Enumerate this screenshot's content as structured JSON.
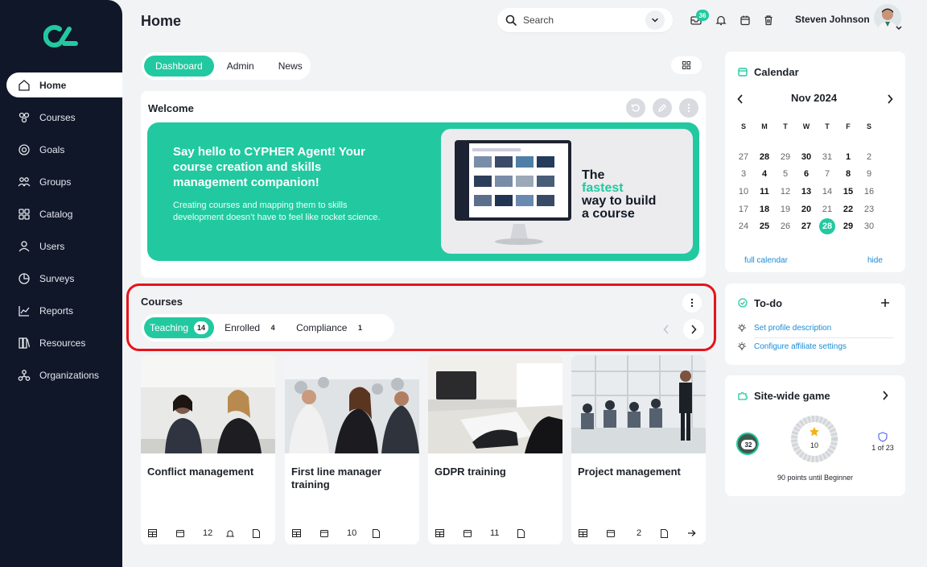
{
  "sidebar": {
    "items": [
      {
        "label": "Home",
        "icon": "home-icon"
      },
      {
        "label": "Courses",
        "icon": "courses-icon"
      },
      {
        "label": "Goals",
        "icon": "goals-icon"
      },
      {
        "label": "Groups",
        "icon": "groups-icon"
      },
      {
        "label": "Catalog",
        "icon": "catalog-icon"
      },
      {
        "label": "Users",
        "icon": "users-icon"
      },
      {
        "label": "Surveys",
        "icon": "surveys-icon"
      },
      {
        "label": "Reports",
        "icon": "reports-icon"
      },
      {
        "label": "Resources",
        "icon": "resources-icon"
      },
      {
        "label": "Organizations",
        "icon": "organizations-icon"
      }
    ]
  },
  "header": {
    "title": "Home",
    "search_label": "Search",
    "inbox_count": "36",
    "user_name": "Steven Johnson"
  },
  "tabs": [
    "Dashboard",
    "Admin",
    "News"
  ],
  "welcome": {
    "title": "Welcome",
    "headline": "Say hello to CYPHER Agent! Your course creation and skills management companion!",
    "body": "Creating courses and mapping them to skills development doesn’t have to feel like rocket science.",
    "tagline_1": "The",
    "tagline_2": "fastest",
    "tagline_3": "way to build",
    "tagline_4": "a course"
  },
  "courses": {
    "title": "Courses",
    "tabs": [
      {
        "label": "Teaching",
        "count": "14"
      },
      {
        "label": "Enrolled",
        "count": "4"
      },
      {
        "label": "Compliance",
        "count": "1"
      }
    ],
    "cards": [
      {
        "title": "Conflict management",
        "count": "12"
      },
      {
        "title": "First line manager training",
        "count": "10"
      },
      {
        "title": "GDPR training",
        "count": "11"
      },
      {
        "title": "Project management",
        "count": "2"
      }
    ]
  },
  "calendar": {
    "title": "Calendar",
    "month": "Nov 2024",
    "dow": [
      "S",
      "M",
      "T",
      "W",
      "T",
      "F",
      "S"
    ],
    "weeks": [
      [
        "27",
        "28",
        "29",
        "30",
        "31",
        "1",
        "2"
      ],
      [
        "3",
        "4",
        "5",
        "6",
        "7",
        "8",
        "9"
      ],
      [
        "10",
        "11",
        "12",
        "13",
        "14",
        "15",
        "16"
      ],
      [
        "17",
        "18",
        "19",
        "20",
        "21",
        "22",
        "23"
      ],
      [
        "24",
        "25",
        "26",
        "27",
        "28",
        "29",
        "30"
      ]
    ],
    "full_link": "full calendar",
    "hide_link": "hide"
  },
  "todo": {
    "title": "To-do",
    "items": [
      "Set profile description",
      "Configure affiliate settings"
    ]
  },
  "game": {
    "title": "Site-wide game",
    "level": "32",
    "stars": "10",
    "rank": "1 of 23",
    "points_text": "90 points until Beginner"
  },
  "colors": {
    "accent": "#22c9a0",
    "sidebar": "#0f1729",
    "link": "#1b8bd6",
    "highlight": "#e5141a"
  }
}
